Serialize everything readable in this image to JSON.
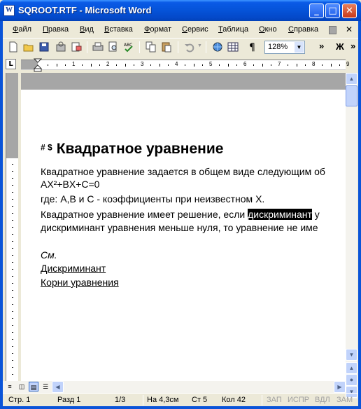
{
  "window": {
    "title": "SQROOT.RTF - Microsoft Word",
    "app_icon": "W"
  },
  "title_buttons": {
    "minimize": "_",
    "maximize": "□",
    "close": "✕"
  },
  "menu": [
    "Файл",
    "Правка",
    "Вид",
    "Вставка",
    "Формат",
    "Сервис",
    "Таблица",
    "Окно",
    "Справка"
  ],
  "toolbar": {
    "zoom": "128%",
    "more": "»",
    "bold": "Ж"
  },
  "ruler": {
    "tab_selector": "L",
    "numbers": [
      "1",
      "2",
      "3",
      "4",
      "5",
      "6",
      "7",
      "8",
      "9"
    ]
  },
  "document": {
    "heading_marks": "# $",
    "heading": "Квадратное уравнение",
    "line1": "Квадратное уравнение задается в общем виде следующим об",
    "line2": "AX²+BX+C=0",
    "line3": "где: A,B и C - коэффициенты при неизвестном X.",
    "line4_before": "Квадратное уравнение имеет решение, если ",
    "line4_highlight": "дискриминант",
    "line4_after": " у",
    "line5": "дискриминант уравнения меньше нуля, то уравнение не име",
    "see": "См.",
    "link1": "Дискриминант",
    "link2": "Корни уравнения"
  },
  "status": {
    "page": "Стр. 1",
    "section": "Разд 1",
    "pages": "1/3",
    "at": "На 4,3см",
    "line": "Ст 5",
    "col": "Кол 42",
    "rec": "ЗАП",
    "trk": "ИСПР",
    "ext": "ВДЛ",
    "ovr": "ЗАМ"
  },
  "colors": {
    "titlebar": "#0553d8",
    "face": "#ece9d8",
    "highlight": "#000000"
  }
}
